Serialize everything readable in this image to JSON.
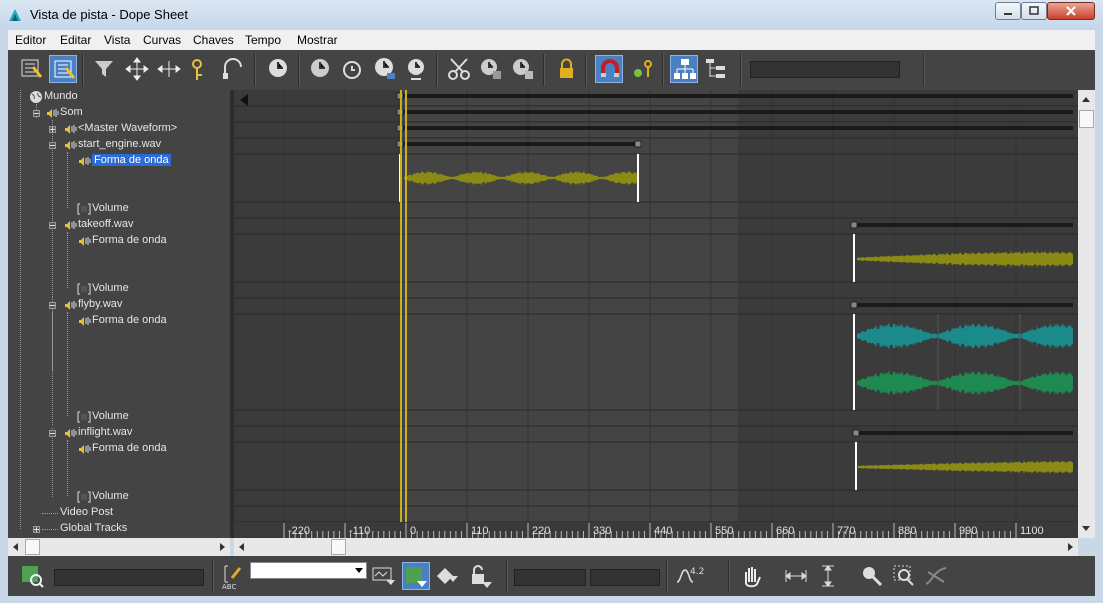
{
  "window": {
    "title": "Vista de pista - Dope Sheet"
  },
  "menu": [
    "Editor",
    "Editar",
    "Vista",
    "Curvas",
    "Chaves",
    "Tempo",
    "Mostrar"
  ],
  "toolbar": {
    "icons": [
      "filter-icon",
      "edit-keys-icon",
      "filters-icon",
      "move-keys-icon",
      "slide-keys-icon",
      "add-keys-icon",
      "scale-keys-icon",
      "select-time-icon",
      "delete-time-icon",
      "reverse-time-icon",
      "scale-time-icon",
      "insert-time-icon",
      "cut-icon",
      "copy-icon",
      "paste-icon",
      "lock-icon",
      "snap-icon",
      "lock-key-icon",
      "modify-subtree-icon",
      "modify-child-keys-icon"
    ]
  },
  "tree": {
    "items": [
      {
        "label": "Mundo"
      },
      {
        "label": "Som"
      },
      {
        "label": "<Master Waveform>"
      },
      {
        "label": "start_engine.wav"
      },
      {
        "label": "Forma de onda"
      },
      {
        "label": "Volume"
      },
      {
        "label": "takeoff.wav"
      },
      {
        "label": "Forma de onda"
      },
      {
        "label": "Volume"
      },
      {
        "label": "flyby.wav"
      },
      {
        "label": "Forma de onda"
      },
      {
        "label": "Volume"
      },
      {
        "label": "inflight.wav"
      },
      {
        "label": "Forma de onda"
      },
      {
        "label": "Volume"
      },
      {
        "label": "Video Post"
      },
      {
        "label": "Global Tracks"
      }
    ]
  },
  "ruler": {
    "labels": [
      "-220",
      "-110",
      "0",
      "110",
      "220",
      "330",
      "440",
      "550",
      "660",
      "770",
      "880",
      "990",
      "1100"
    ]
  },
  "statusbar": {
    "value_42": "4.2"
  },
  "colors": {
    "waveform_olive": "#8a8a14",
    "waveform_teal": "#1a8a8a",
    "waveform_green": "#1f8a50",
    "time_slider": "#c8b020",
    "selection": "#2b6bd6"
  }
}
